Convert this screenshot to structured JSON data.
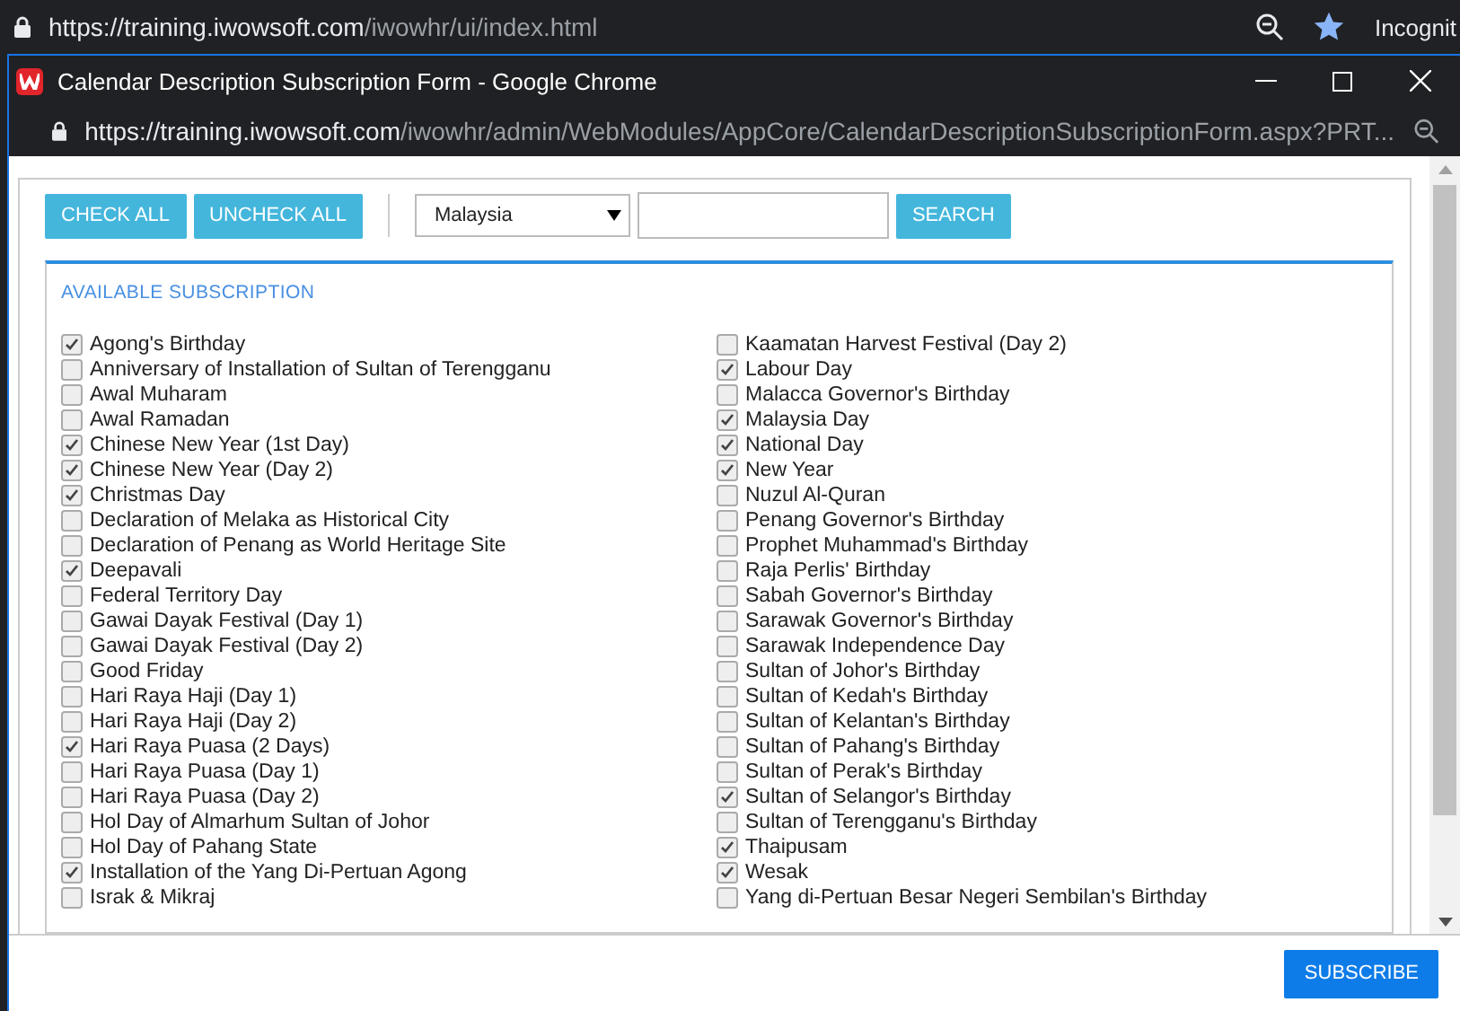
{
  "browser": {
    "url_host": "https://training.iwowsoft.com",
    "url_path": "/iwowhr/ui/index.html",
    "profile": "Incognit"
  },
  "popup": {
    "title": "Calendar Description Subscription Form - Google Chrome",
    "url_host": "https://training.iwowsoft.com",
    "url_path": "/iwowhr/admin/WebModules/AppCore/CalendarDescriptionSubscriptionForm.aspx?PRT..."
  },
  "toolbar": {
    "buttons": [
      "CHECK ALL",
      "UNCHECK ALL"
    ],
    "country": "Malaysia",
    "search_button": "SEARCH"
  },
  "panel_title": "AVAILABLE SUBSCRIPTION",
  "subscriptions": [
    {
      "label": "Agong's Birthday",
      "checked": true
    },
    {
      "label": "Anniversary of Installation of Sultan of Terengganu",
      "checked": false
    },
    {
      "label": "Awal Muharam",
      "checked": false
    },
    {
      "label": "Awal Ramadan",
      "checked": false
    },
    {
      "label": "Chinese New Year (1st Day)",
      "checked": true
    },
    {
      "label": "Chinese New Year (Day 2)",
      "checked": true
    },
    {
      "label": "Christmas Day",
      "checked": true
    },
    {
      "label": "Declaration of Melaka as Historical City",
      "checked": false
    },
    {
      "label": "Declaration of Penang as World Heritage Site",
      "checked": false
    },
    {
      "label": "Deepavali",
      "checked": true
    },
    {
      "label": "Federal Territory Day",
      "checked": false
    },
    {
      "label": "Gawai Dayak Festival (Day 1)",
      "checked": false
    },
    {
      "label": "Gawai Dayak Festival (Day 2)",
      "checked": false
    },
    {
      "label": "Good Friday",
      "checked": false
    },
    {
      "label": "Hari Raya Haji (Day 1)",
      "checked": false
    },
    {
      "label": "Hari Raya Haji (Day 2)",
      "checked": false
    },
    {
      "label": "Hari Raya Puasa (2 Days)",
      "checked": true
    },
    {
      "label": "Hari Raya Puasa (Day 1)",
      "checked": false
    },
    {
      "label": "Hari Raya Puasa (Day 2)",
      "checked": false
    },
    {
      "label": "Hol Day of Almarhum Sultan of Johor",
      "checked": false
    },
    {
      "label": "Hol Day of Pahang State",
      "checked": false
    },
    {
      "label": "Installation of the Yang Di-Pertuan Agong",
      "checked": true
    },
    {
      "label": "Israk & Mikraj",
      "checked": false
    },
    {
      "label": "Kaamatan Harvest Festival (Day 2)",
      "checked": false
    },
    {
      "label": "Labour Day",
      "checked": true
    },
    {
      "label": "Malacca Governor's Birthday",
      "checked": false
    },
    {
      "label": "Malaysia Day",
      "checked": true
    },
    {
      "label": "National Day",
      "checked": true
    },
    {
      "label": "New Year",
      "checked": true
    },
    {
      "label": "Nuzul Al-Quran",
      "checked": false
    },
    {
      "label": "Penang Governor's Birthday",
      "checked": false
    },
    {
      "label": "Prophet Muhammad's Birthday",
      "checked": false
    },
    {
      "label": "Raja Perlis' Birthday",
      "checked": false
    },
    {
      "label": "Sabah Governor's Birthday",
      "checked": false
    },
    {
      "label": "Sarawak Governor's Birthday",
      "checked": false
    },
    {
      "label": "Sarawak Independence Day",
      "checked": false
    },
    {
      "label": "Sultan of Johor's Birthday",
      "checked": false
    },
    {
      "label": "Sultan of Kedah's Birthday",
      "checked": false
    },
    {
      "label": "Sultan of Kelantan's Birthday",
      "checked": false
    },
    {
      "label": "Sultan of Pahang's Birthday",
      "checked": false
    },
    {
      "label": "Sultan of Perak's Birthday",
      "checked": false
    },
    {
      "label": "Sultan of Selangor's Birthday",
      "checked": true
    },
    {
      "label": "Sultan of Terengganu's Birthday",
      "checked": false
    },
    {
      "label": "Thaipusam",
      "checked": true
    },
    {
      "label": "Wesak",
      "checked": true
    },
    {
      "label": "Yang di-Pertuan Besar Negeri Sembilan's Birthday",
      "checked": false
    }
  ],
  "footer": {
    "submit": "SUBSCRIBE"
  }
}
